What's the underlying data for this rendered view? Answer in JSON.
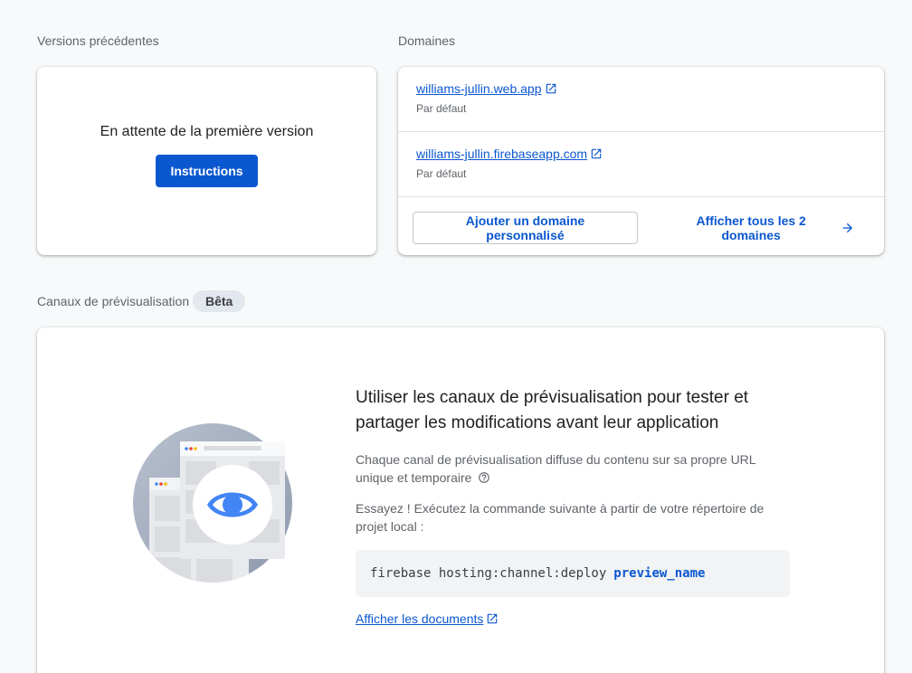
{
  "versions": {
    "section_label": "Versions précédentes",
    "empty_text": "En attente de la première version",
    "instructions_button": "Instructions"
  },
  "domains": {
    "section_label": "Domaines",
    "items": [
      {
        "url": "williams-jullin.web.app",
        "subtitle": "Par défaut"
      },
      {
        "url": "williams-jullin.firebaseapp.com",
        "subtitle": "Par défaut"
      }
    ],
    "add_custom_button": "Ajouter un domaine personnalisé",
    "view_all_button": "Afficher tous les 2 domaines"
  },
  "preview": {
    "section_label": "Canaux de prévisualisation",
    "badge": "Bêta",
    "title": "Utiliser les canaux de prévisualisation pour tester et partager les modifications avant leur application",
    "description": "Chaque canal de prévisualisation diffuse du contenu sur sa propre URL unique et temporaire",
    "try_text": "Essayez ! Exécutez la commande suivante à partir de votre répertoire de projet local :",
    "command": "firebase hosting:channel:deploy",
    "command_arg": "preview_name",
    "docs_link": "Afficher les documents"
  },
  "colors": {
    "accent": "#0b57d0",
    "background": "#f8f9fa",
    "badge_bg": "#e3e7ee"
  },
  "icons": [
    "open-in-new-icon",
    "arrow-forward-icon",
    "help-circle-icon",
    "eye-icon"
  ]
}
